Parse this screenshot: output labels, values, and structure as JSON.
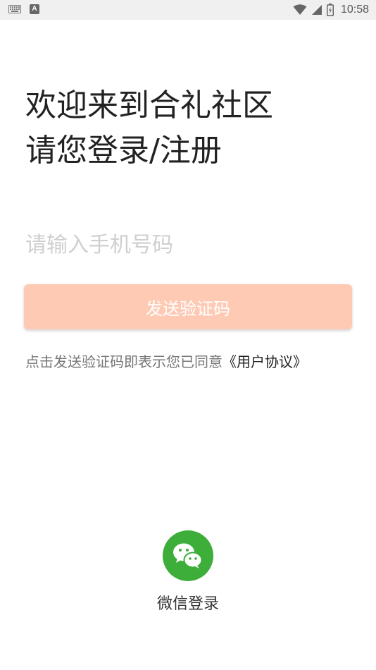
{
  "status_bar": {
    "time": "10:58",
    "a_badge": "A",
    "icons": [
      "keyboard-icon",
      "a-badge-icon",
      "wifi-icon",
      "cellular-signal-icon",
      "battery-icon"
    ]
  },
  "welcome": {
    "line1": "欢迎来到合礼社区",
    "line2": "请您登录/注册"
  },
  "phone": {
    "value": "",
    "placeholder": "请输入手机号码"
  },
  "send_button": {
    "label": "发送验证码",
    "color": "#fecab4"
  },
  "agreement": {
    "text": "点击发送验证码即表示您已同意",
    "link": "《用户协议》"
  },
  "wechat": {
    "label": "微信登录",
    "icon": "wechat-icon",
    "color": "#3dae3a"
  }
}
